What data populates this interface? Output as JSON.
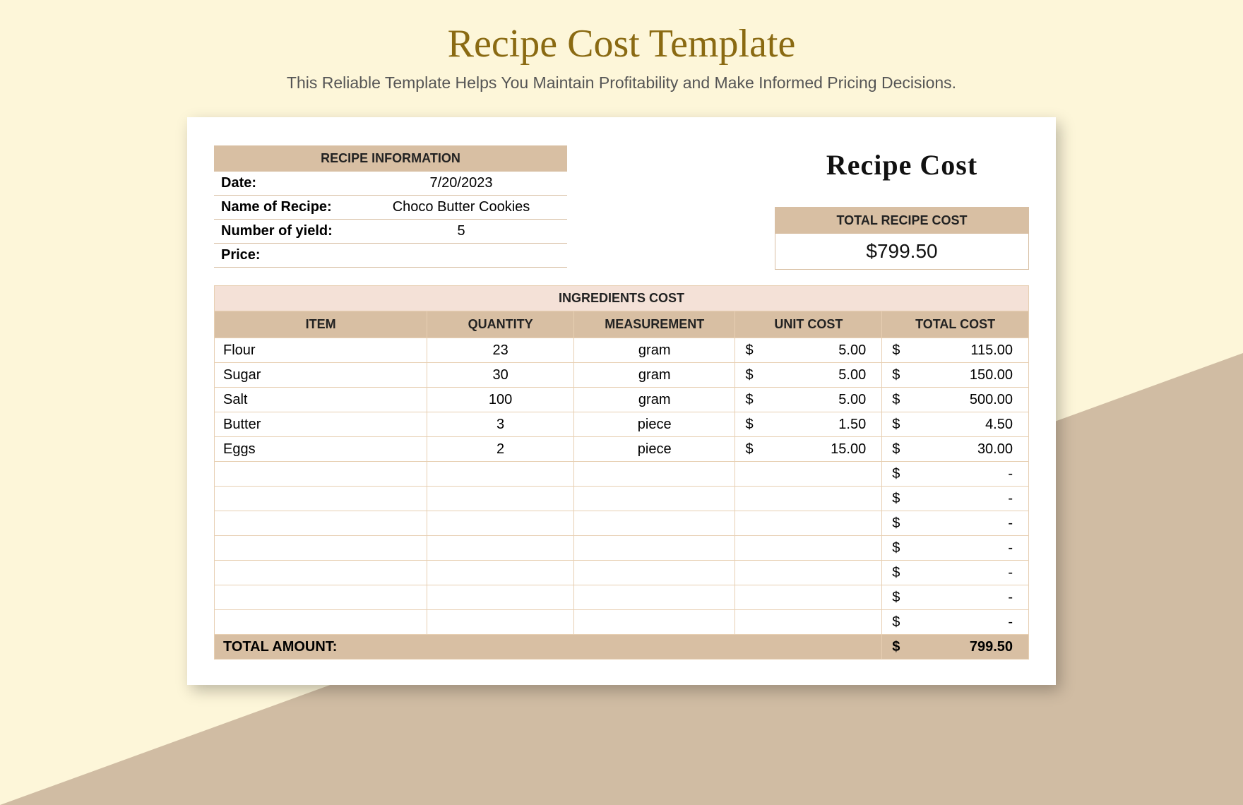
{
  "page": {
    "title": "Recipe Cost Template",
    "subtitle": "This Reliable Template Helps You Maintain Profitability and Make Informed Pricing Decisions."
  },
  "info": {
    "header": "RECIPE INFORMATION",
    "rows": [
      {
        "label": "Date:",
        "value": "7/20/2023"
      },
      {
        "label": "Name of Recipe:",
        "value": "Choco Butter Cookies"
      },
      {
        "label": "Number of yield:",
        "value": "5"
      },
      {
        "label": "Price:",
        "value": ""
      }
    ]
  },
  "recipeCostTitle": "Recipe Cost",
  "totalBox": {
    "header": "TOTAL RECIPE COST",
    "value": "$799.50"
  },
  "ingredients": {
    "sectionTitle": "INGREDIENTS COST",
    "columns": {
      "item": "ITEM",
      "qty": "QUANTITY",
      "meas": "MEASUREMENT",
      "unit": "UNIT COST",
      "total": "TOTAL COST"
    },
    "rows": [
      {
        "item": "Flour",
        "qty": "23",
        "meas": "gram",
        "unit": "5.00",
        "total": "115.00"
      },
      {
        "item": "Sugar",
        "qty": "30",
        "meas": "gram",
        "unit": "5.00",
        "total": "150.00"
      },
      {
        "item": "Salt",
        "qty": "100",
        "meas": "gram",
        "unit": "5.00",
        "total": "500.00"
      },
      {
        "item": "Butter",
        "qty": "3",
        "meas": "piece",
        "unit": "1.50",
        "total": "4.50"
      },
      {
        "item": "Eggs",
        "qty": "2",
        "meas": "piece",
        "unit": "15.00",
        "total": "30.00"
      },
      {
        "item": "",
        "qty": "",
        "meas": "",
        "unit": "",
        "total": "-"
      },
      {
        "item": "",
        "qty": "",
        "meas": "",
        "unit": "",
        "total": "-"
      },
      {
        "item": "",
        "qty": "",
        "meas": "",
        "unit": "",
        "total": "-"
      },
      {
        "item": "",
        "qty": "",
        "meas": "",
        "unit": "",
        "total": "-"
      },
      {
        "item": "",
        "qty": "",
        "meas": "",
        "unit": "",
        "total": "-"
      },
      {
        "item": "",
        "qty": "",
        "meas": "",
        "unit": "",
        "total": "-"
      },
      {
        "item": "",
        "qty": "",
        "meas": "",
        "unit": "",
        "total": "-"
      }
    ],
    "footer": {
      "label": "TOTAL AMOUNT:",
      "value": "799.50"
    }
  },
  "currencySymbol": "$"
}
